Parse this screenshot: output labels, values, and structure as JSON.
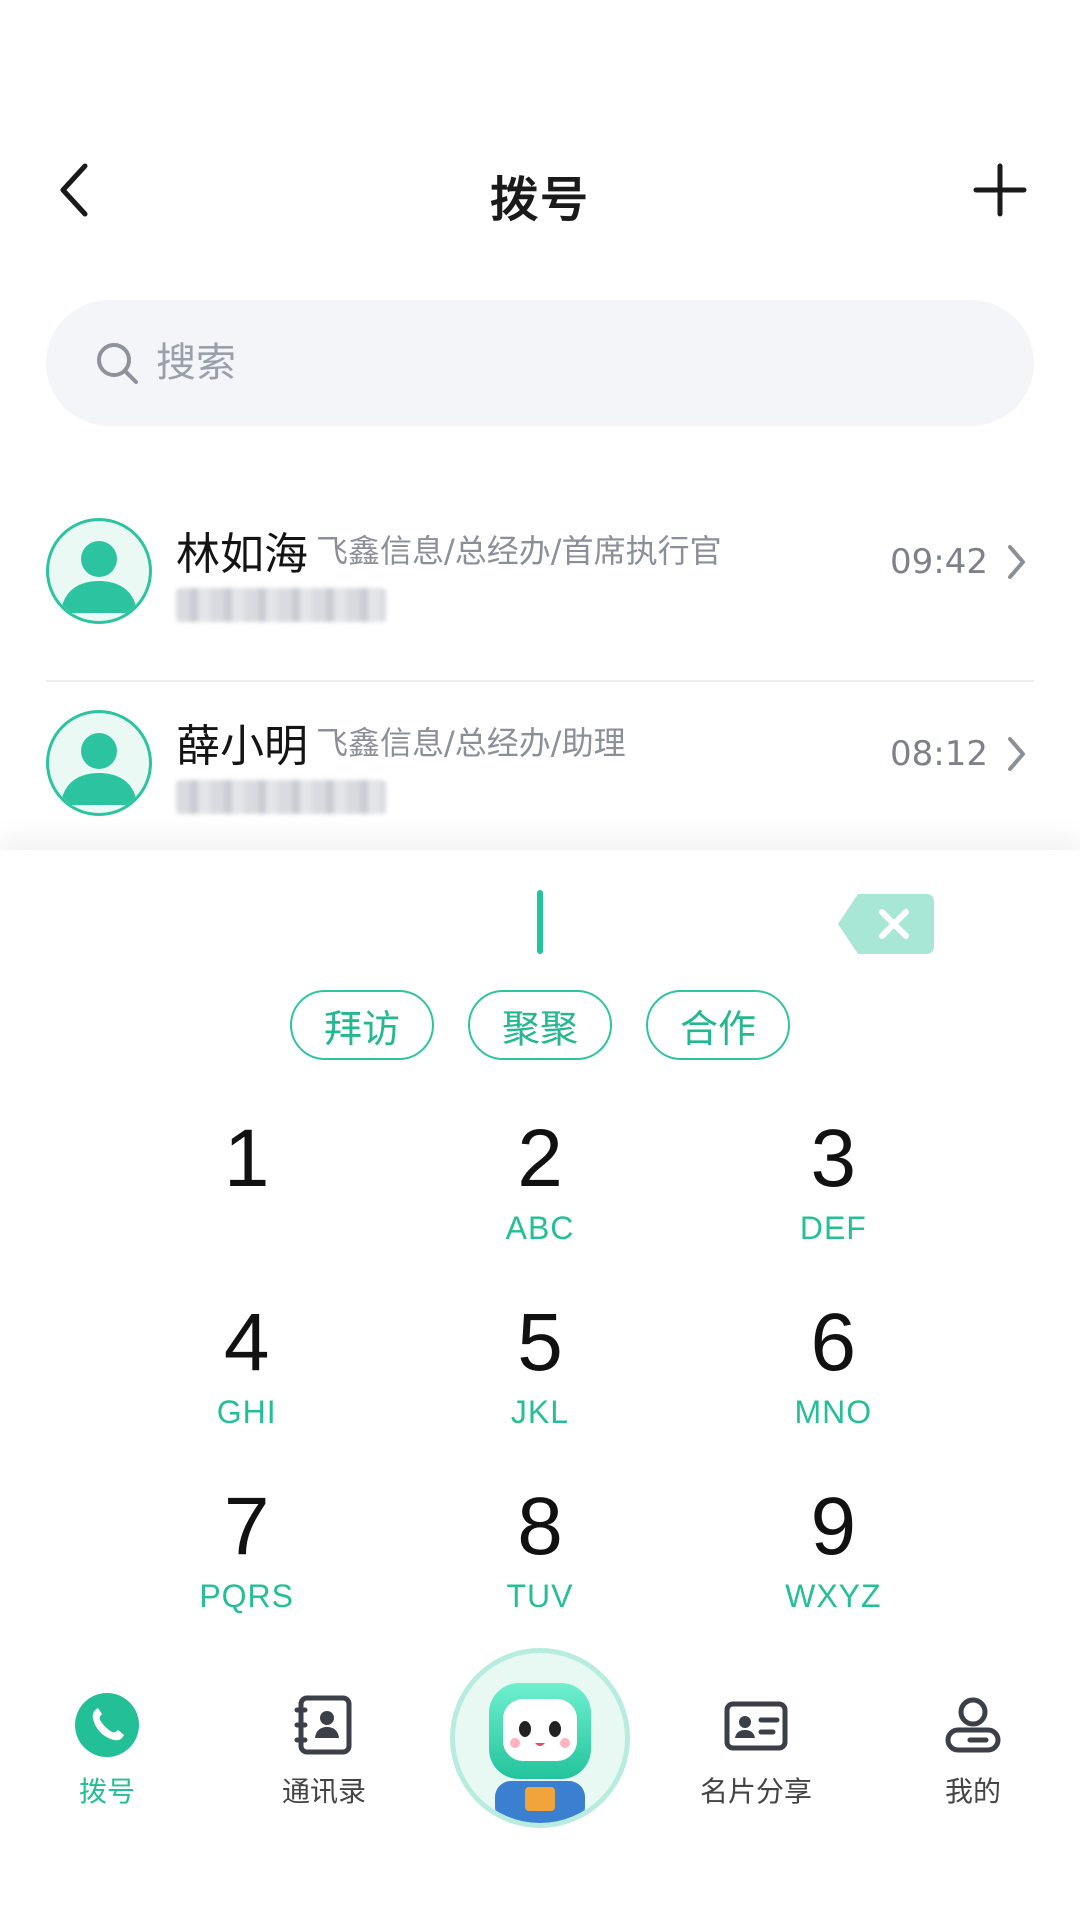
{
  "header": {
    "title": "拨号"
  },
  "search": {
    "placeholder": "搜索"
  },
  "recent_calls": [
    {
      "name": "林如海",
      "dept": "飞鑫信息/总经办/首席执行官",
      "time": "09:42"
    },
    {
      "name": "薛小明",
      "dept": "飞鑫信息/总经办/助理",
      "time": "08:12"
    }
  ],
  "tags": [
    "拜访",
    "聚聚",
    "合作"
  ],
  "keypad": [
    {
      "digit": "1",
      "letters": ""
    },
    {
      "digit": "2",
      "letters": "ABC"
    },
    {
      "digit": "3",
      "letters": "DEF"
    },
    {
      "digit": "4",
      "letters": "GHI"
    },
    {
      "digit": "5",
      "letters": "JKL"
    },
    {
      "digit": "6",
      "letters": "MNO"
    },
    {
      "digit": "7",
      "letters": "PQRS"
    },
    {
      "digit": "8",
      "letters": "TUV"
    },
    {
      "digit": "9",
      "letters": "WXYZ"
    }
  ],
  "nav": {
    "dial": "拨号",
    "contacts": "通讯录",
    "card_share": "名片分享",
    "mine": "我的"
  },
  "colors": {
    "accent": "#23bf97",
    "background": "#ffffff"
  }
}
